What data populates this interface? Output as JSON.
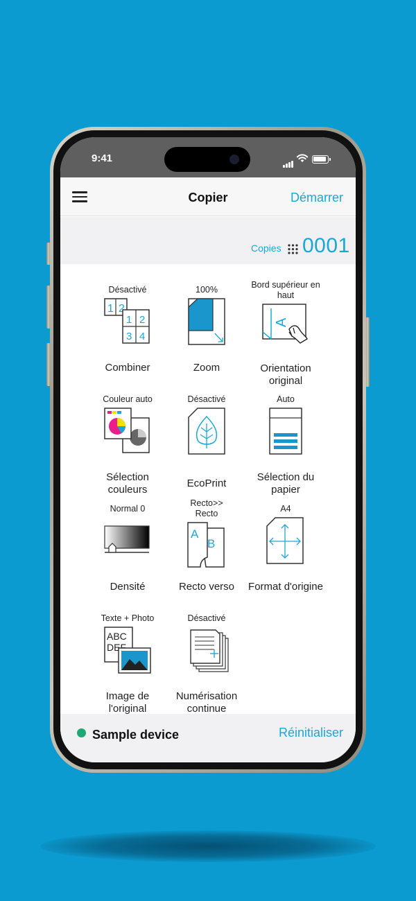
{
  "status_bar": {
    "time": "9:41"
  },
  "navbar": {
    "title": "Copier",
    "start_label": "Démarrer",
    "menu_icon": "hamburger-menu-icon"
  },
  "copies": {
    "label": "Copies",
    "value": "0001",
    "icon": "keypad-icon"
  },
  "functions": [
    {
      "value": "Désactivé",
      "label": "Combiner",
      "icon": "combine-pages-icon"
    },
    {
      "value": "100%",
      "label": "Zoom",
      "icon": "zoom-icon"
    },
    {
      "value": "Bord supérieur en haut",
      "label": "Orientation original",
      "icon": "original-orientation-icon"
    },
    {
      "value": "Couleur auto",
      "label": "Sélection couleurs",
      "icon": "color-selection-icon"
    },
    {
      "value": "Désactivé",
      "label": "EcoPrint",
      "icon": "ecoprint-leaf-icon"
    },
    {
      "value": "Auto",
      "label": "Sélection du papier",
      "icon": "paper-tray-icon"
    },
    {
      "value": "Normal 0",
      "label": "Densité",
      "icon": "density-slider-icon"
    },
    {
      "value": "Recto>> Recto",
      "label": "Recto verso",
      "icon": "duplex-icon"
    },
    {
      "value": "A4",
      "label": "Format d'origine",
      "icon": "original-size-icon"
    },
    {
      "value": "Texte + Photo",
      "label": "Image de l'original",
      "icon": "original-image-icon"
    },
    {
      "value": "Désactivé",
      "label": "Numérisation continue",
      "icon": "continuous-scan-icon"
    }
  ],
  "footer": {
    "device_name": "Sample device",
    "reset_label": "Réinitialiser",
    "status_color": "#1fa874"
  },
  "colors": {
    "accent": "#1ba7d6",
    "background": "#0b9bd0"
  }
}
